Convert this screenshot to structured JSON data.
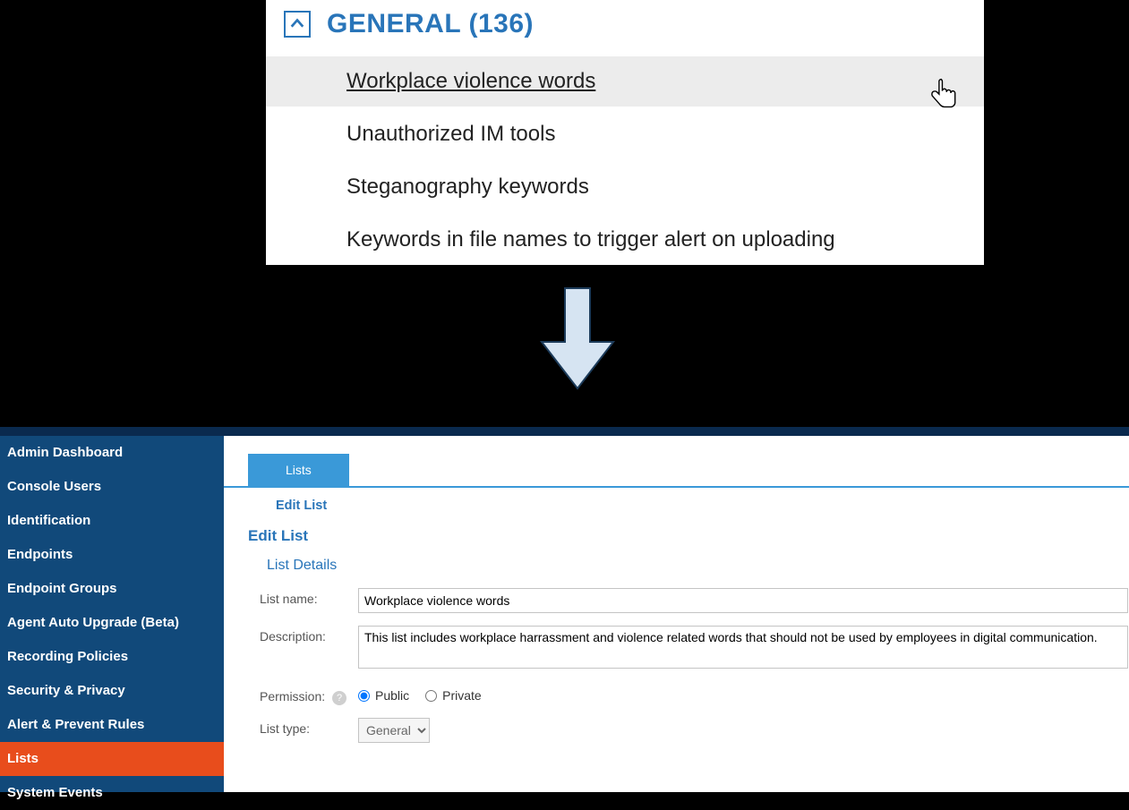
{
  "general_panel": {
    "header_label": "GENERAL",
    "count": "(136)",
    "rows": [
      "Workplace violence words",
      "Unauthorized IM tools",
      "Steganography keywords",
      "Keywords in file names to trigger alert on uploading"
    ]
  },
  "sidebar": {
    "items": [
      "Admin Dashboard",
      "Console Users",
      "Identification",
      "Endpoints",
      "Endpoint Groups",
      "Agent Auto Upgrade (Beta)",
      "Recording Policies",
      "Security & Privacy",
      "Alert & Prevent Rules",
      "Lists",
      "System Events"
    ],
    "active_index": 9
  },
  "tabs": {
    "main": "Lists"
  },
  "breadcrumb": "Edit List",
  "page_heading": "Edit List",
  "list_details": {
    "section_title": "List Details",
    "labels": {
      "list_name": "List name:",
      "description": "Description:",
      "permission": "Permission:",
      "list_type": "List type:"
    },
    "list_name_value": "Workplace violence words",
    "description_value": "This list includes workplace harrassment and violence related words that should not be used by employees in digital communication.",
    "permission_options": {
      "public": "Public",
      "private": "Private"
    },
    "permission_selected": "public",
    "list_type_options": [
      "General"
    ],
    "list_type_selected": "General",
    "help_tooltip_glyph": "?"
  }
}
